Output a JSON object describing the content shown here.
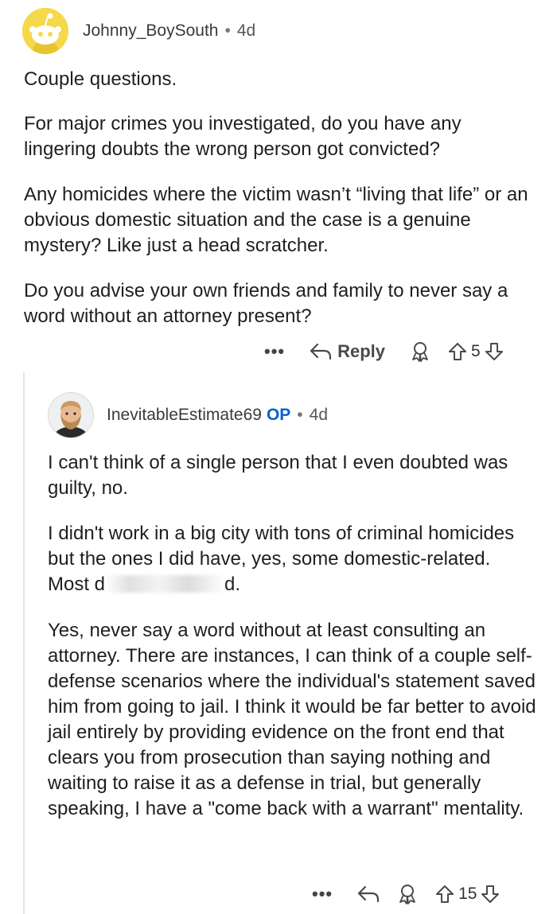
{
  "parent": {
    "username": "Johnny_BoySouth",
    "age": "4d",
    "paragraphs": [
      "Couple questions.",
      "For major crimes you investigated, do you have any lingering doubts the wrong person got convicted?",
      "Any homicides where the victim wasn’t “living that life” or an obvious domestic situation and the case is a genuine mystery? Like just a head scratcher.",
      "Do you advise your own friends and family to never say a word without an attorney present?"
    ],
    "actions": {
      "more": "•••",
      "reply": "Reply",
      "votes": "5"
    }
  },
  "reply": {
    "username": "InevitableEstimate69",
    "op_badge": "OP",
    "age": "4d",
    "paragraphs": [
      "I can't think of a single person that I even doubted was guilty, no.",
      "I didn't work in a big city with tons of criminal homicides but the ones I did have, yes, some domestic-related. Most d",
      "d.",
      "Yes, never say a word without at least consulting an attorney. There are instances, I can think of a couple self-defense scenarios where the individual's statement saved him from going to jail. I think it would be far better to avoid jail entirely by providing evidence on the front end that clears you from prosecution than saying nothing and waiting to raise it as a defense in trial, but generally speaking, I have a \"come back with a warrant\" mentality."
    ],
    "actions": {
      "more": "•••",
      "votes": "15"
    }
  },
  "colors": {
    "snoo_yellow": "#f5d94a",
    "op_blue": "#0b5fd1",
    "thread_line": "#e4e4e4"
  },
  "icons": [
    "reply-arrow-icon",
    "award-icon",
    "upvote-icon",
    "downvote-icon",
    "more-icon"
  ]
}
